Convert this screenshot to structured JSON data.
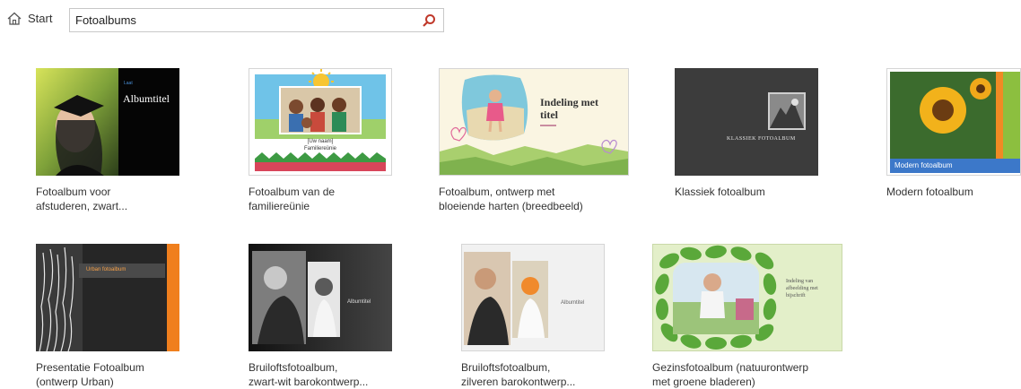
{
  "header": {
    "home_label": "Start",
    "search_value": "Fotoalbums"
  },
  "templates": [
    {
      "caption_1": "Fotoalbum voor",
      "caption_2": "afstuderen, zwart...",
      "thumb_text": "Albumtitel",
      "thumb_tag": "Laat"
    },
    {
      "caption_1": "Fotoalbum van de",
      "caption_2": "familiereünie",
      "thumb_text_1": "[Uw naam]",
      "thumb_text_2": "Familiereünie"
    },
    {
      "caption_1": "Fotoalbum, ontwerp met",
      "caption_2": "bloeiende harten (breedbeeld)",
      "thumb_text_1": "Indeling met",
      "thumb_text_2": "titel"
    },
    {
      "caption_1": "Klassiek fotoalbum",
      "caption_2": "",
      "thumb_text": "KLASSIEK FOTOALBUM"
    },
    {
      "caption_1": "Modern fotoalbum",
      "caption_2": "",
      "thumb_text": "Modern fotoalbum"
    },
    {
      "caption_1": "Presentatie Fotoalbum",
      "caption_2": "(ontwerp Urban)",
      "thumb_text": "Urban fotoalbum"
    },
    {
      "caption_1": "Bruiloftsfotoalbum,",
      "caption_2": "zwart-wit barokontwerp...",
      "thumb_text": "Albumtitel"
    },
    {
      "caption_1": "Bruiloftsfotoalbum,",
      "caption_2": "zilveren barokontwerp...",
      "thumb_text": "Albumtitel"
    },
    {
      "caption_1": "Gezinsfotoalbum (natuurontwerp",
      "caption_2": "met groene bladeren)",
      "thumb_text_1": "Indeling van",
      "thumb_text_2": "afbeelding met",
      "thumb_text_3": "bijschrift"
    }
  ]
}
